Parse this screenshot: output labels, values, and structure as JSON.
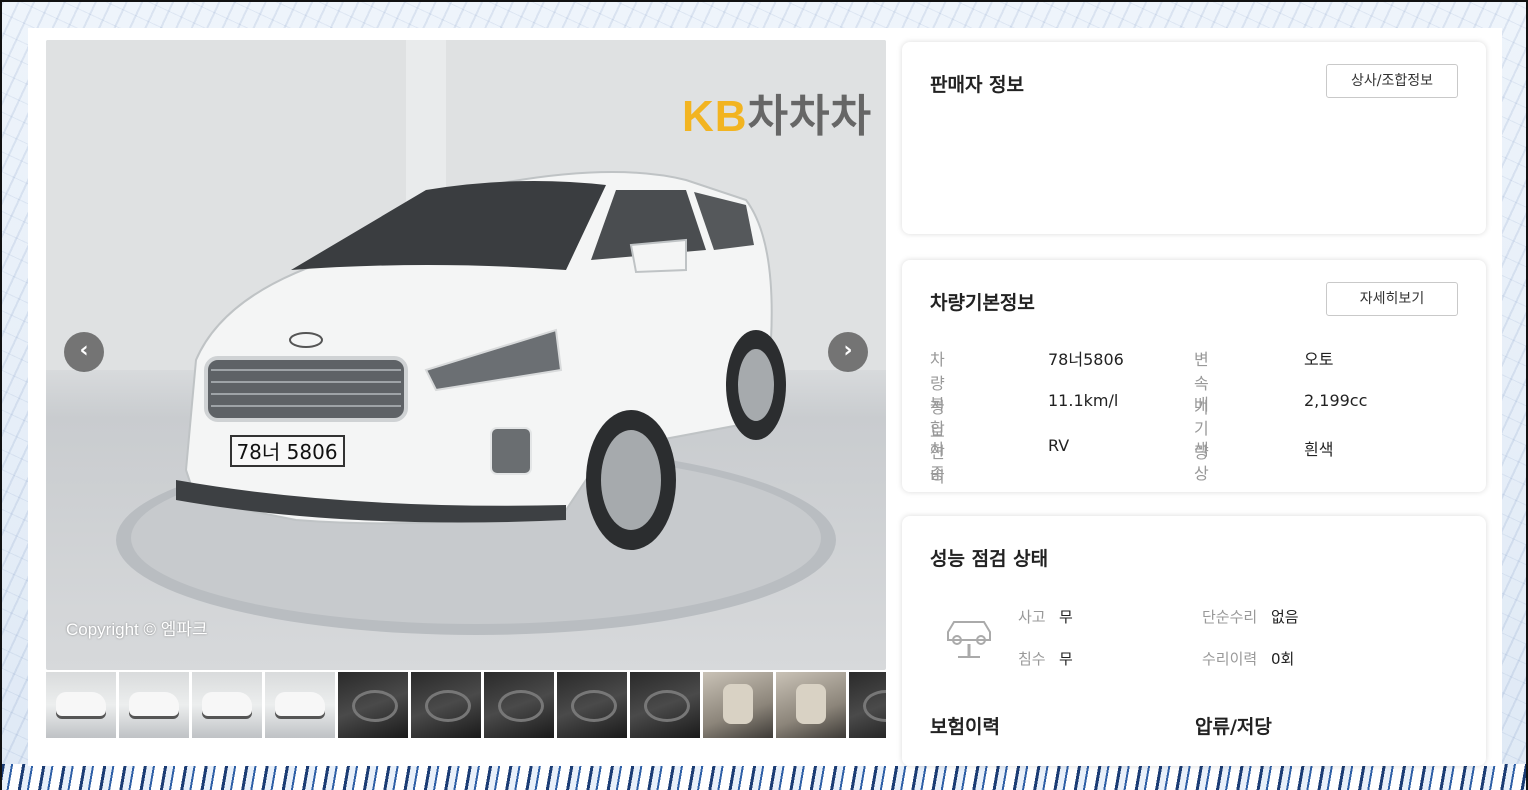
{
  "photo": {
    "logo_prefix": "KB",
    "logo_name": "차차차",
    "copyright": "Copyright © 엠파크",
    "plate": "78너 5806",
    "prev_icon": "chevron-left-icon",
    "next_icon": "chevron-right-icon"
  },
  "thumbnails": [
    "car",
    "car",
    "car",
    "car",
    "dark",
    "dark",
    "dark",
    "dark",
    "dark",
    "interior",
    "interior",
    "dark"
  ],
  "seller": {
    "title": "판매자 정보",
    "button": "상사/조합정보"
  },
  "basic_info": {
    "title": "차량기본정보",
    "button": "자세히보기",
    "rows": [
      {
        "l1": "차량정보",
        "v1": "78너5806",
        "l2": "변속기",
        "v2": "오토"
      },
      {
        "l1": "복합연비",
        "v1": "11.1km/l",
        "l2": "배기량",
        "v2": "2,199cc"
      },
      {
        "l1": "차종",
        "v1": "RV",
        "l2": "색상",
        "v2": "흰색"
      }
    ]
  },
  "inspection": {
    "title": "성능 점검 상태",
    "icon": "car-lift-icon",
    "accident_label": "사고",
    "accident_value": "무",
    "simple_repair_label": "단순수리",
    "simple_repair_value": "없음",
    "flood_label": "침수",
    "flood_value": "무",
    "repair_history_label": "수리이력",
    "repair_history_value": "0회",
    "insurance_title": "보험이력",
    "seizure_title": "압류/저당"
  },
  "colors": {
    "accent_logo": "#f2b421",
    "label_gray": "#999999"
  }
}
